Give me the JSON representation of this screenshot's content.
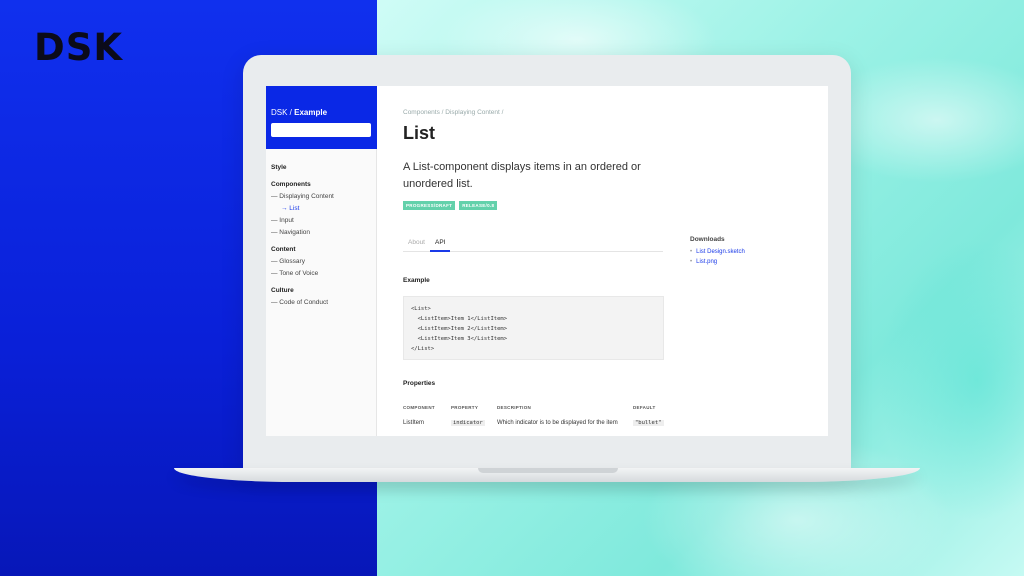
{
  "brand": {
    "logo": "DSK"
  },
  "sidebar": {
    "title_prefix": "DSK / ",
    "title_bold": "Example",
    "groups": [
      {
        "label": "Style",
        "items": []
      },
      {
        "label": "Components",
        "items": [
          "— Displaying Content",
          "→ List",
          "— Input",
          "— Navigation"
        ]
      },
      {
        "label": "Content",
        "items": [
          "— Glossary",
          "— Tone of Voice"
        ]
      },
      {
        "label": "Culture",
        "items": [
          "— Code of Conduct"
        ]
      }
    ]
  },
  "main": {
    "breadcrumb": "Components / Displaying Content /",
    "title": "List",
    "lead": "A List-component displays items in an ordered or unordered list.",
    "badges": [
      "PROGRESS/DRAFT",
      "RELEASE/0.8"
    ],
    "tabs": [
      {
        "label": "About"
      },
      {
        "label": "API"
      }
    ],
    "example_heading": "Example",
    "code_lines": [
      "<List>",
      "  <ListItem>Item 1</ListItem>",
      "  <ListItem>Item 2</ListItem>",
      "  <ListItem>Item 3</ListItem>",
      "</List>"
    ],
    "properties_heading": "Properties",
    "table": {
      "headers": [
        "COMPONENT",
        "PROPERTY",
        "DESCRIPTION",
        "DEFAULT"
      ],
      "rows": [
        [
          "ListItem",
          "indicator",
          "Which indicator is to be displayed for the item",
          "\"bullet\""
        ]
      ]
    }
  },
  "downloads": {
    "heading": "Downloads",
    "items": [
      "List Design.sketch",
      "List.png"
    ]
  },
  "colors": {
    "brand_blue": "#0a28e6",
    "badge_green": "#63d1ab",
    "mint_bg": "#a6f5ea"
  }
}
